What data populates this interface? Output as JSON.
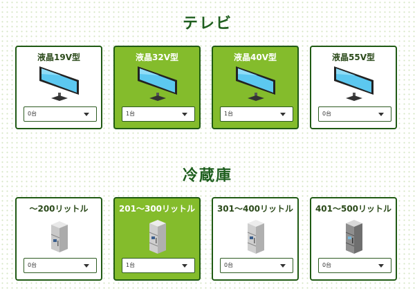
{
  "sections": {
    "tv": {
      "title": "テレビ",
      "items": [
        {
          "label": "液晶19V型",
          "quantity": "0台",
          "selected": false,
          "icon": "tv-icon"
        },
        {
          "label": "液晶32V型",
          "quantity": "1台",
          "selected": true,
          "icon": "tv-icon"
        },
        {
          "label": "液晶40V型",
          "quantity": "1台",
          "selected": true,
          "icon": "tv-icon"
        },
        {
          "label": "液晶55V型",
          "quantity": "0台",
          "selected": false,
          "icon": "tv-icon"
        }
      ]
    },
    "fridge": {
      "title": "冷蔵庫",
      "items": [
        {
          "label": "～200リットル",
          "quantity": "0台",
          "selected": false,
          "icon": "fridge-small-icon"
        },
        {
          "label": "201～300リットル",
          "quantity": "1台",
          "selected": true,
          "icon": "fridge-icon"
        },
        {
          "label": "301～400リットル",
          "quantity": "0台",
          "selected": false,
          "icon": "fridge-icon"
        },
        {
          "label": "401～500リットル",
          "quantity": "0台",
          "selected": false,
          "icon": "fridge-dark-icon"
        }
      ]
    }
  },
  "colors": {
    "selected_card": "#84bc2c",
    "border": "#1f5a13",
    "title": "#1e5e1e"
  }
}
